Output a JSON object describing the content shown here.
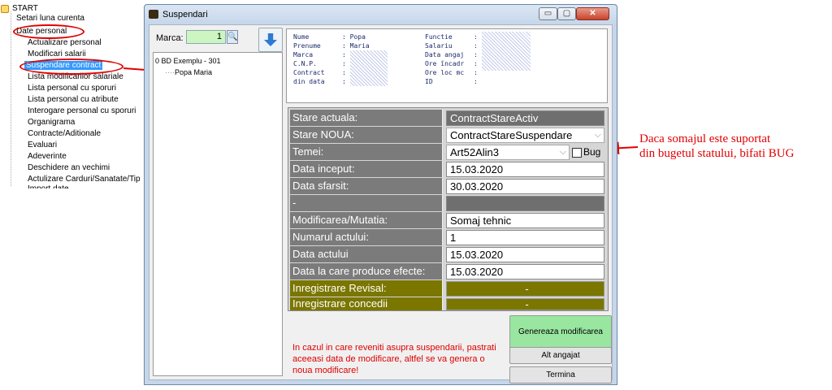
{
  "tree": {
    "root": "START",
    "items": [
      "Setari luna curenta",
      "Date personal",
      "Actualizare personal",
      "Modificari salarii",
      "Suspendare contract",
      "Lista modificarilor salariale",
      "Lista personal cu sporuri",
      "Lista personal cu atribute",
      "Interogare personal cu sporuri",
      "Organigrama",
      "Contracte/Aditionale",
      "Evaluari",
      "Adeverinte",
      "Deschidere an vechimi",
      "Actulizare Carduri/Sanatate/Tip",
      "Import date"
    ]
  },
  "window": {
    "title": "Suspendari",
    "controls": {
      "minimize": "▭",
      "maximize": "▢",
      "close": "✕"
    },
    "marca_label": "Marca:",
    "marca_value": "1",
    "list": {
      "unit": "0 BD Exemplu - 301",
      "employee": "Popa Maria"
    },
    "info": {
      "left": [
        {
          "label": "Nume",
          "value": ": Popa"
        },
        {
          "label": "Prenume",
          "value": ": Maria"
        },
        {
          "label": "Marca",
          "value": ":"
        },
        {
          "label": "C.N.P.",
          "value": ":"
        },
        {
          "label": "Contract",
          "value": ":"
        },
        {
          "label": "din data",
          "value": ":"
        }
      ],
      "right": [
        {
          "label": "Functie",
          "value": ":"
        },
        {
          "label": "Salariu",
          "value": ":"
        },
        {
          "label": "Data angaj",
          "value": ":"
        },
        {
          "label": "Ore încadr",
          "value": ":"
        },
        {
          "label": "Ore loc mc",
          "value": ":"
        },
        {
          "label": "ID",
          "value": ":"
        }
      ]
    },
    "grid": {
      "stare_actuala": {
        "label": "Stare actuala:",
        "value": "ContractStareActiv"
      },
      "stare_noua": {
        "label": "Stare NOUA:",
        "value": "ContractStareSuspendare"
      },
      "temei": {
        "label": "Temei:",
        "value": "Art52Alin3",
        "checkbox_label": "Bug"
      },
      "data_inceput": {
        "label": "Data inceput:",
        "value": "15.03.2020"
      },
      "data_sfarsit": {
        "label": "Data sfarsit:",
        "value": "30.03.2020"
      },
      "separator": {
        "label": "-",
        "value": ""
      },
      "modificarea": {
        "label": "Modificarea/Mutatia:",
        "value": "Somaj tehnic"
      },
      "numarul_actului": {
        "label": "Numarul actului:",
        "value": "1"
      },
      "data_actului": {
        "label": "Data actului",
        "value": "15.03.2020"
      },
      "data_efecte": {
        "label": "Data la care produce efecte:",
        "value": "15.03.2020"
      },
      "revisal": {
        "label": "Inregistrare Revisal:",
        "value": "-"
      },
      "concedii": {
        "label": "Inregistrare concedii",
        "value": "-"
      }
    },
    "note": "In cazul in care reveniti asupra suspendarii, pastrati aceeasi data de modificare, altfel se va genera o noua modificare!",
    "buttons": {
      "genereaza": "Genereaza modificarea",
      "alt_angajat": "Alt angajat",
      "termina": "Termina"
    }
  },
  "annotation": {
    "line1": "Daca somajul este suportat",
    "line2": "din bugetul statului, bifati BUG"
  },
  "colors": {
    "annotation_red": "#e00000",
    "selection_blue": "#3399ff",
    "olive": "#7a7600",
    "green_button": "#99e6a0"
  }
}
